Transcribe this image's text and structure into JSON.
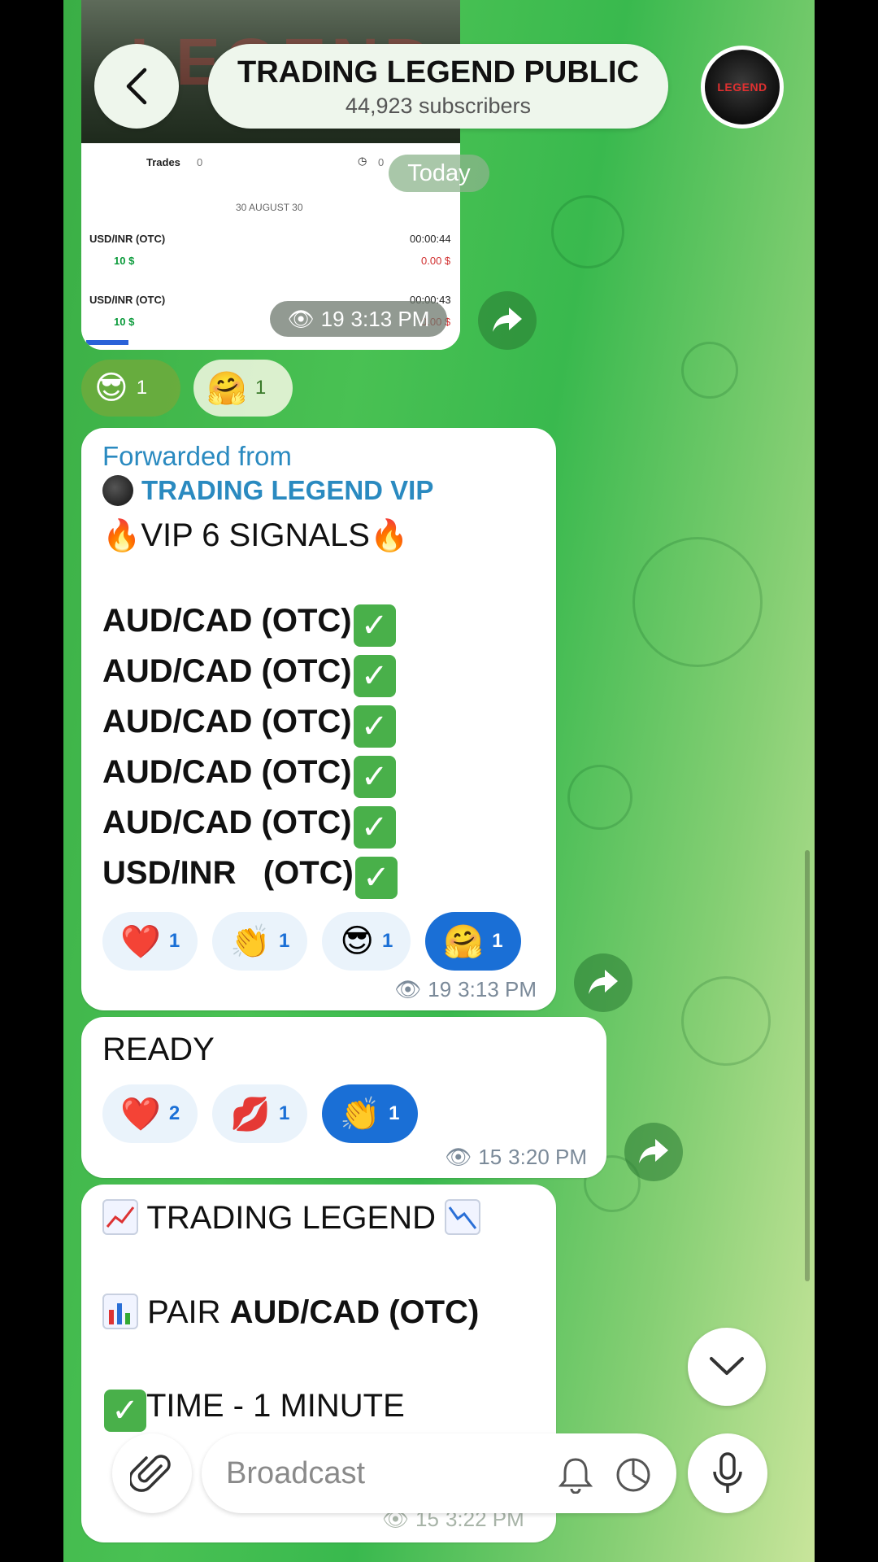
{
  "header": {
    "title": "TRADING LEGEND PUBLIC",
    "subtitle": "44,923 subscribers"
  },
  "date_divider": "Today",
  "image_message": {
    "trades_label": "Trades",
    "trades_count": "0",
    "clock_count": "0",
    "date": "30 AUGUST 30",
    "rows": [
      {
        "pair": "USD/INR (OTC)",
        "time": "00:00:44",
        "amount": "10 $",
        "result": "0.00 $"
      },
      {
        "pair": "USD/INR (OTC)",
        "time": "00:00:43",
        "amount": "10 $",
        "result": "0.00 $"
      }
    ],
    "views": "19",
    "time": "3:13 PM",
    "reactions": [
      {
        "emoji": "😎",
        "count": "1"
      },
      {
        "emoji": "🤗",
        "count": "1"
      }
    ]
  },
  "signals_message": {
    "forwarded_label": "Forwarded from",
    "source": "TRADING LEGEND VIP",
    "heading": "VIP 6 SIGNALS",
    "fire": "🔥",
    "lines": [
      "AUD/CAD (OTC)",
      "AUD/CAD (OTC)",
      "AUD/CAD (OTC)",
      "AUD/CAD (OTC)",
      "AUD/CAD (OTC)",
      "USD/INR   (OTC)"
    ],
    "check": "✓",
    "reactions": [
      {
        "emoji": "❤️",
        "count": "1",
        "active": false
      },
      {
        "emoji": "👏",
        "count": "1",
        "active": false
      },
      {
        "emoji": "😎",
        "count": "1",
        "active": false
      },
      {
        "emoji": "🤗",
        "count": "1",
        "active": true
      }
    ],
    "views": "19",
    "time": "3:13 PM"
  },
  "ready_message": {
    "text": "READY",
    "reactions": [
      {
        "emoji": "❤️",
        "count": "2",
        "active": false
      },
      {
        "emoji": "💋",
        "count": "1",
        "active": false
      },
      {
        "emoji": "👏",
        "count": "1",
        "active": true
      }
    ],
    "views": "15",
    "time": "3:20 PM"
  },
  "legend_message": {
    "title": "TRADING LEGEND",
    "pair_label": "PAIR",
    "pair_value": "AUD/CAD (OTC)",
    "time_line": "TIME - 1 MINUTE",
    "views": "15",
    "time": "3:22 PM"
  },
  "input": {
    "placeholder": "Broadcast"
  }
}
